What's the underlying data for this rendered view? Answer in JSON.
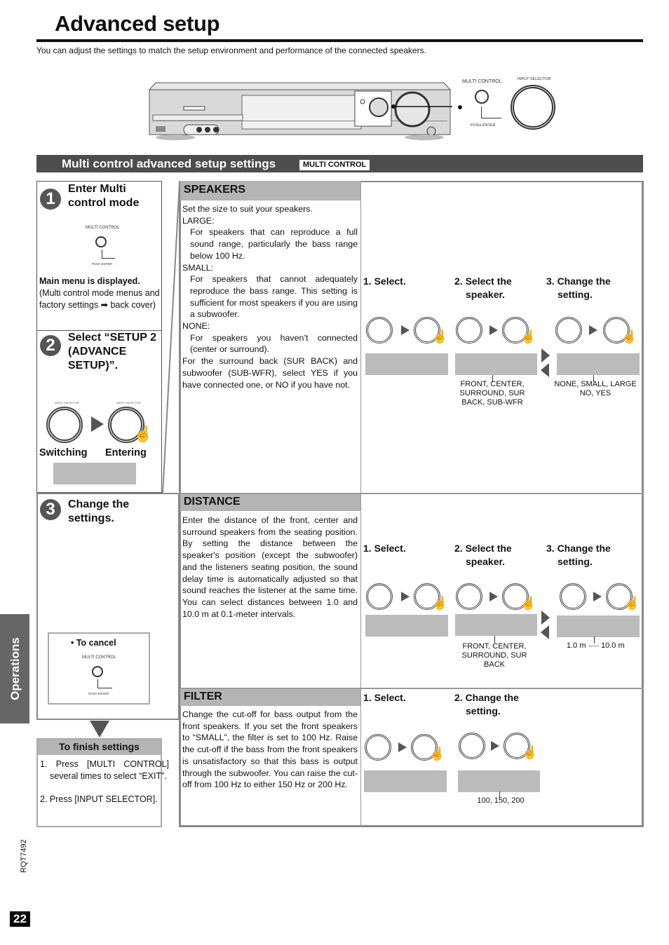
{
  "page": {
    "title": "Advanced setup",
    "intro": "You can adjust the settings to match the setup environment and performance of the connected speakers.",
    "page_number": "22",
    "doc_code": "RQT7492",
    "side_tab": "Operations"
  },
  "device": {
    "multi_control_label": "MULTI CONTROL",
    "push_enter_label": "PUSH ENTER",
    "input_selector_label": "INPUT SELECTOR"
  },
  "section": {
    "title": "Multi control advanced setup settings",
    "badge": "MULTI CONTROL"
  },
  "steps": [
    {
      "number": "1",
      "heading": "Enter Multi control mode",
      "button_label": "MULTI CONTROL",
      "push_label": "PUSH ENTER",
      "result_bold": "Main menu is displayed.",
      "result_note": "(Multi control mode menus and factory settings ➡ back cover)"
    },
    {
      "number": "2",
      "heading": "Select “SETUP 2 (ADVANCE SETUP)”.",
      "dial_label": "INPUT SELECTOR",
      "switching": "Switching",
      "entering": "Entering"
    },
    {
      "number": "3",
      "heading": "Change the settings.",
      "cancel_label": "• To cancel",
      "button_label": "MULTI CONTROL",
      "push_label": "PUSH ENTER"
    }
  ],
  "finish": {
    "heading": "To finish settings",
    "items": [
      "1. Press [MULTI CONTROL] several times to select “EXIT”.",
      "2. Press [INPUT SELECTOR]."
    ]
  },
  "settings": {
    "speakers": {
      "heading": "SPEAKERS",
      "intro": "Set the size to suit your speakers.",
      "large_label": "LARGE:",
      "large_text": "For speakers that can reproduce a full sound range, particularly the bass range below 100 Hz.",
      "small_label": "SMALL:",
      "small_text": "For speakers that cannot adequately reproduce the bass range. This setting is sufficient for most speakers if you are using a subwoofer.",
      "none_label": "NONE:",
      "none_text": "For speakers you haven’t connected (center or surround).",
      "outro": "For the surround back (SUR BACK) and subwoofer (SUB-WFR), select YES if you have connected one, or NO if you have not.",
      "step1": "1. Select.",
      "step2": "2. Select the speaker.",
      "step3": "3. Change the setting.",
      "speaker_options": "FRONT, CENTER, SURROUND, SUR BACK, SUB-WFR",
      "setting_options": "NONE, SMALL, LARGE NO, YES"
    },
    "distance": {
      "heading": "DISTANCE",
      "text": "Enter the distance of the front, center and surround speakers from the seating position. By setting the distance between the speaker's position (except the subwoofer) and the listeners seating position, the sound delay time is automatically adjusted so that sound reaches the listener at the same time.  You can select distances between 1.0 and 10.0 m at 0.1-meter intervals.",
      "step1": "1. Select.",
      "step2": "2. Select the speaker.",
      "step3": "3. Change the setting.",
      "speaker_options": "FRONT, CENTER, SURROUND, SUR BACK",
      "range_min": "1.0 m",
      "range_max": "10.0 m"
    },
    "filter": {
      "heading": "FILTER",
      "text": "Change the cut-off for bass output from the front speakers. If you set the front speakers to “SMALL”, the filter is set to 100 Hz. Raise the cut-off if the bass from the front speakers is unsatisfactory so that this bass is output through the subwoofer. You can raise the cut-off from 100 Hz to either 150 Hz or 200 Hz.",
      "step1": "1. Select.",
      "step2": "2. Change the setting.",
      "options": "100, 150, 200"
    }
  },
  "dial_label": "INPUT SELECTOR"
}
